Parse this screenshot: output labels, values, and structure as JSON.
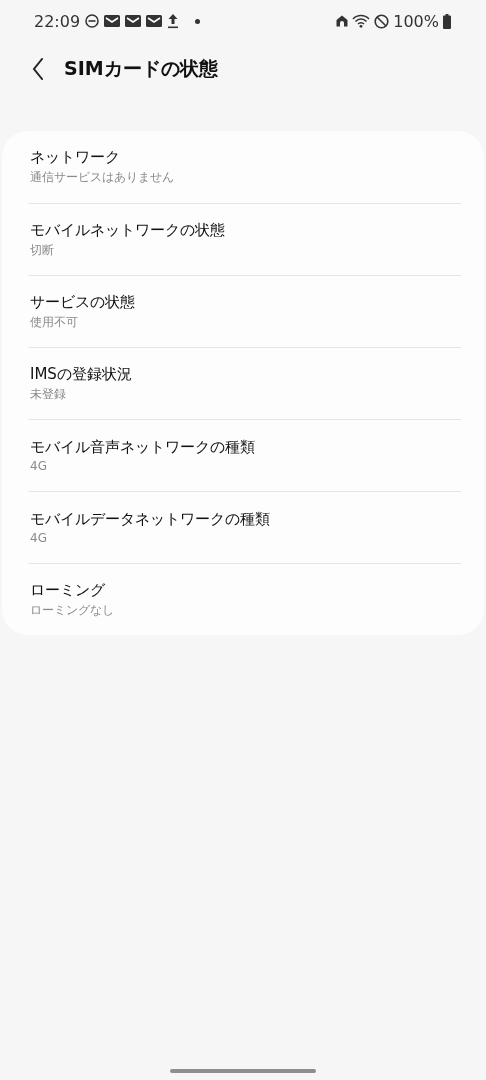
{
  "status_bar": {
    "time": "22:09",
    "battery": "100%"
  },
  "header": {
    "title": "SIMカードの状態"
  },
  "items": [
    {
      "title": "ネットワーク",
      "value": "通信サービスはありません"
    },
    {
      "title": "モバイルネットワークの状態",
      "value": "切断"
    },
    {
      "title": "サービスの状態",
      "value": "使用不可"
    },
    {
      "title": "IMSの登録状況",
      "value": "未登録"
    },
    {
      "title": "モバイル音声ネットワークの種類",
      "value": "4G"
    },
    {
      "title": "モバイルデータネットワークの種類",
      "value": "4G"
    },
    {
      "title": "ローミング",
      "value": "ローミングなし"
    }
  ]
}
